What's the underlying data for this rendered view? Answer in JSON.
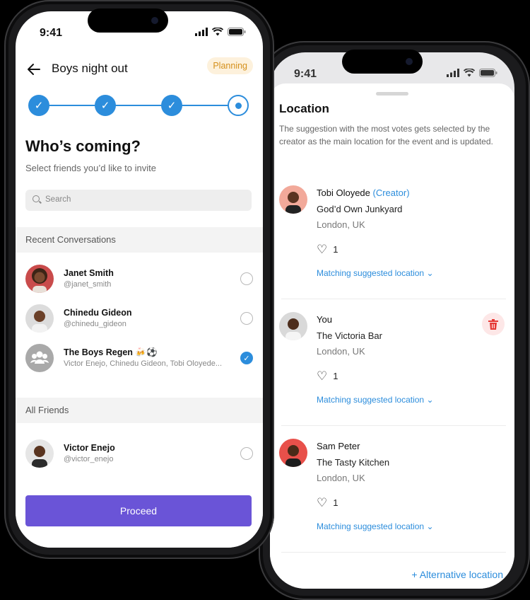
{
  "front": {
    "status_time": "9:41",
    "title": "Boys night out",
    "badge": "Planning",
    "heading": "Who’s coming?",
    "subtitle": "Select friends you’d like to invite",
    "search_placeholder": "Search",
    "recent_header": "Recent Conversations",
    "recent": [
      {
        "name": "Janet Smith",
        "handle": "@janet_smith",
        "selected": false
      },
      {
        "name": "Chinedu Gideon",
        "handle": "@chinedu_gideon",
        "selected": false
      },
      {
        "name": "The Boys Regen 🍻⚽",
        "handle": "Victor Enejo, Chinedu Gideon, Tobi Oloyede...",
        "selected": true
      }
    ],
    "friends_header": "All Friends",
    "friends": [
      {
        "name": "Victor Enejo",
        "handle": "@victor_enejo",
        "selected": false
      }
    ],
    "proceed_label": "Proceed"
  },
  "back": {
    "status_time": "9:41",
    "title": "Location",
    "description": "The suggestion with the most votes gets selected by the creator as the main location for the event and is updated.",
    "suggestions": [
      {
        "user": "Tobi Oloyede",
        "role": "(Creator)",
        "place": "God’d Own Junkyard",
        "city": "London, UK",
        "likes": "1",
        "match_label": "Matching suggested location"
      },
      {
        "user": "You",
        "role": "",
        "place": "The Victoria Bar",
        "city": "London, UK",
        "likes": "1",
        "match_label": "Matching suggested location"
      },
      {
        "user": "Sam Peter",
        "role": "",
        "place": "The Tasty Kitchen",
        "city": "London, UK",
        "likes": "1",
        "match_label": "Matching suggested location"
      }
    ],
    "alt_label": "Alternative location"
  },
  "colors": {
    "accent": "#2c8ddc",
    "primary_button": "#6a54d7",
    "badge_bg": "#fdf1dc",
    "badge_text": "#d4901c",
    "delete": "#e53935"
  }
}
